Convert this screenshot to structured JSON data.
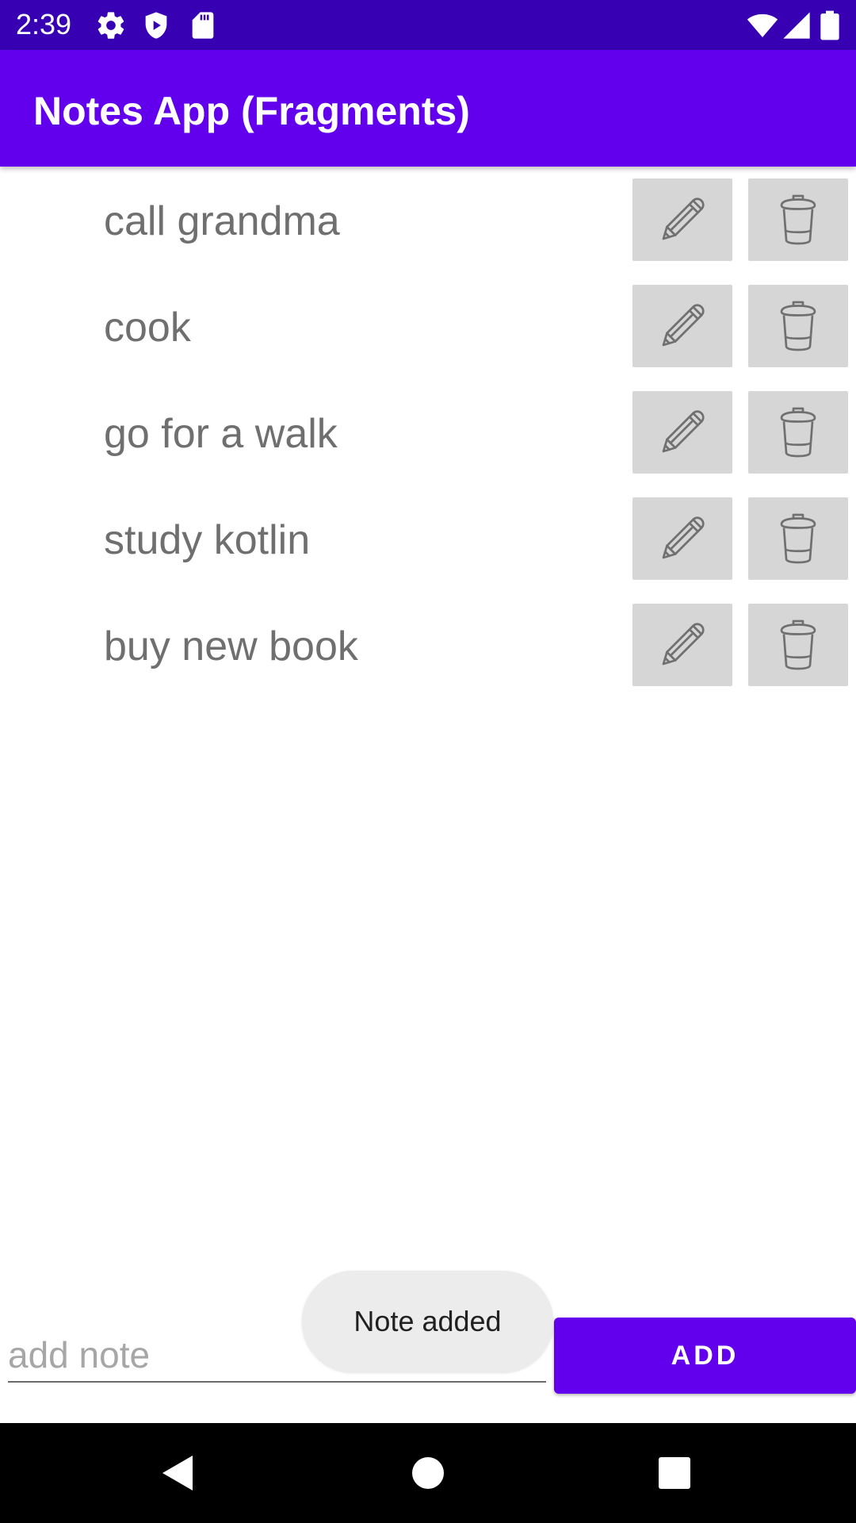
{
  "status_bar": {
    "time": "2:39",
    "left_icons": [
      "gear-icon",
      "shield-icon",
      "sd-card-icon"
    ],
    "right_icons": [
      "wifi-icon",
      "cell-signal-icon",
      "battery-icon"
    ]
  },
  "app_bar": {
    "title": "Notes App (Fragments)"
  },
  "notes": [
    {
      "text": "call grandma"
    },
    {
      "text": "cook"
    },
    {
      "text": "go for a walk"
    },
    {
      "text": "study kotlin"
    },
    {
      "text": "buy new book"
    }
  ],
  "note_actions": {
    "edit_icon": "pencil-icon",
    "delete_icon": "trash-icon"
  },
  "input": {
    "value": "",
    "placeholder": "add note"
  },
  "add_button": {
    "label": "ADD"
  },
  "toast": {
    "message": "Note added"
  },
  "nav_bar": {
    "buttons": [
      "back-icon",
      "home-icon",
      "recents-icon"
    ]
  },
  "colors": {
    "status_bar": "#3700b3",
    "primary": "#6200ee",
    "icon_button_bg": "#d6d6d6",
    "note_text": "#6f6f6f"
  }
}
